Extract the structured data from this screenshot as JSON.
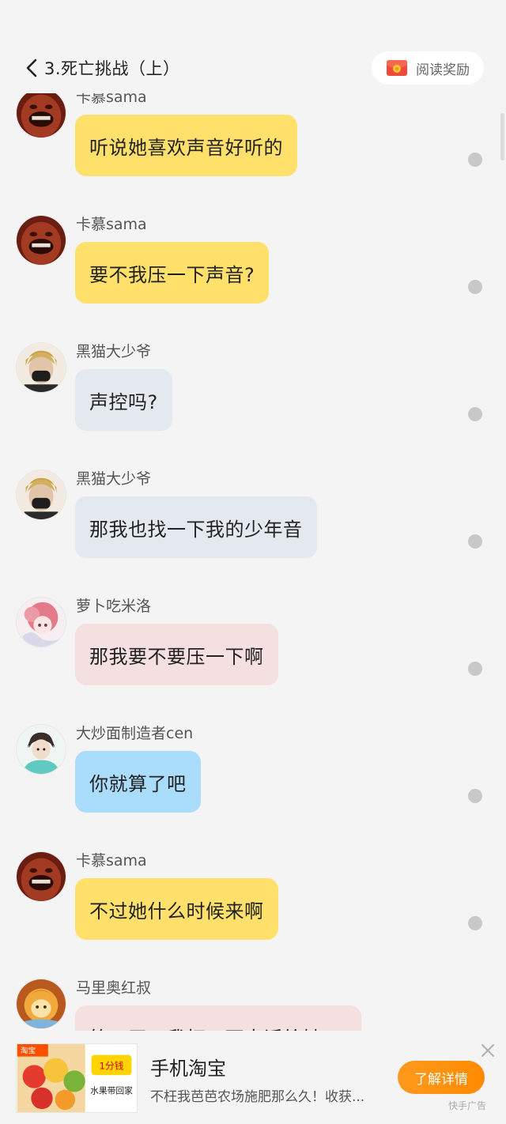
{
  "header": {
    "title": "3.死亡挑战（上）",
    "reward_label": "阅读奖励"
  },
  "messages": [
    {
      "user": "卡慕sama",
      "text": "听说她喜欢声音好听的",
      "bubble_color": "#ffe06b",
      "avatar": "kamu-avatar"
    },
    {
      "user": "卡慕sama",
      "text": "要不我压一下声音?",
      "bubble_color": "#ffe06b",
      "avatar": "kamu-avatar"
    },
    {
      "user": "黑猫大少爷",
      "text": "声控吗?",
      "bubble_color": "#e4e8ef",
      "avatar": "heimao-avatar"
    },
    {
      "user": "黑猫大少爷",
      "text": "那我也找一下我的少年音",
      "bubble_color": "#e4e8ef",
      "avatar": "heimao-avatar"
    },
    {
      "user": "萝卜吃米洛",
      "text": "那我要不要压一下啊",
      "bubble_color": "#f4dfe1",
      "avatar": "luobo-avatar"
    },
    {
      "user": "大炒面制造者cen",
      "text": "你就算了吧",
      "bubble_color": "#a9ddfb",
      "avatar": "dachaomian-avatar"
    },
    {
      "user": "卡慕sama",
      "text": "不过她什么时候来啊",
      "bubble_color": "#ffe06b",
      "avatar": "kamu-avatar"
    },
    {
      "user": "马里奥红叔",
      "text": "第一天，我打一下电话给她",
      "bubble_color": "#f4dfe1",
      "avatar": "mario-avatar"
    }
  ],
  "ad": {
    "image_brand": "淘宝",
    "image_price": "1分钱",
    "image_caption": "水果带回家",
    "title": "手机淘宝",
    "description": "不枉我芭芭农场施肥那么久！收获...",
    "cta_label": "了解详情",
    "ad_label": "快手广告"
  },
  "colors": {
    "background": "#f4f4f4",
    "bubble_yellow": "#ffe06b",
    "bubble_gray": "#e4e8ef",
    "bubble_pink": "#f4dfe1",
    "bubble_blue": "#a9ddfb",
    "cta_orange": "#ff9a1e"
  }
}
